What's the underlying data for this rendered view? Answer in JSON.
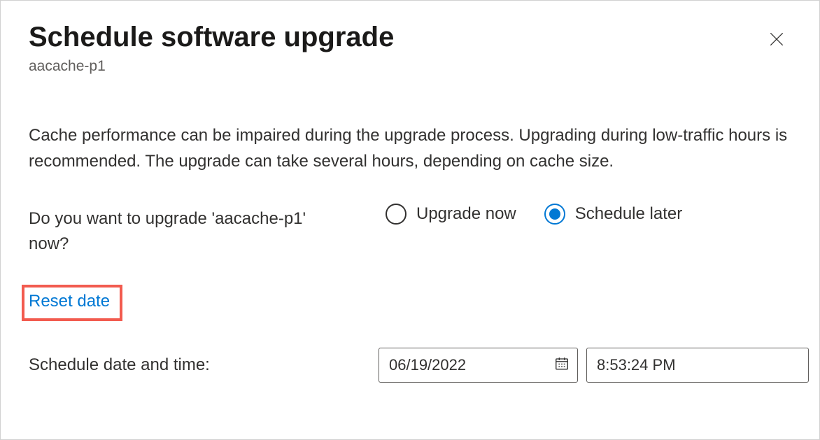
{
  "header": {
    "title": "Schedule software upgrade",
    "subtitle": "aacache-p1"
  },
  "description": "Cache performance can be impaired during the upgrade process. Upgrading during low-traffic hours is recommended. The upgrade can take several hours, depending on cache size.",
  "question": "Do you want to upgrade 'aacache-p1' now?",
  "radio": {
    "upgrade_now_label": "Upgrade now",
    "schedule_later_label": "Schedule later",
    "selected": "schedule_later"
  },
  "reset_link_label": "Reset date",
  "schedule": {
    "label": "Schedule date and time:",
    "date_value": "06/19/2022",
    "time_value": "8:53:24 PM"
  }
}
